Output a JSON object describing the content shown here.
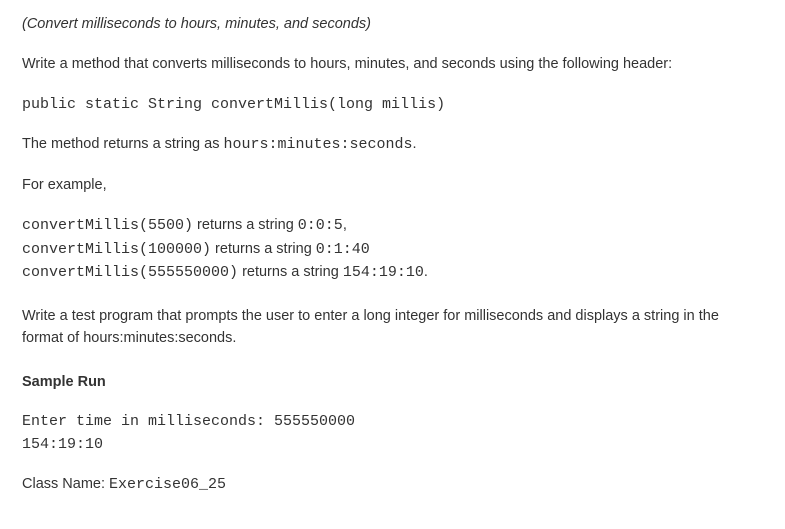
{
  "title": "(Convert milliseconds to hours, minutes, and seconds)",
  "intro": "Write a method that converts milliseconds to hours, minutes, and seconds using the following header:",
  "method_signature": "public static String convertMillis(long millis)",
  "returns_prefix": "The method returns a string as ",
  "returns_format": "hours:minutes:seconds",
  "returns_suffix": ".",
  "for_example": "For example,",
  "examples": [
    {
      "call": "convertMillis(5500)",
      "mid": " returns a string ",
      "result": "0:0:5",
      "tail": ","
    },
    {
      "call": "convertMillis(100000)",
      "mid": "  returns a string ",
      "result": "0:1:40",
      "tail": ""
    },
    {
      "call": "convertMillis(555550000)",
      "mid": "  returns a string ",
      "result": "154:19:10",
      "tail": "."
    }
  ],
  "test_program": "Write a test program that prompts the user to enter a long integer for milliseconds and displays a string in the format of hours:minutes:seconds.",
  "sample_run_heading": "Sample Run",
  "sample_run": {
    "line1": "Enter time in milliseconds: 555550000",
    "line2": "154:19:10"
  },
  "class_label": "Class Name: ",
  "class_name": "Exercise06_25"
}
